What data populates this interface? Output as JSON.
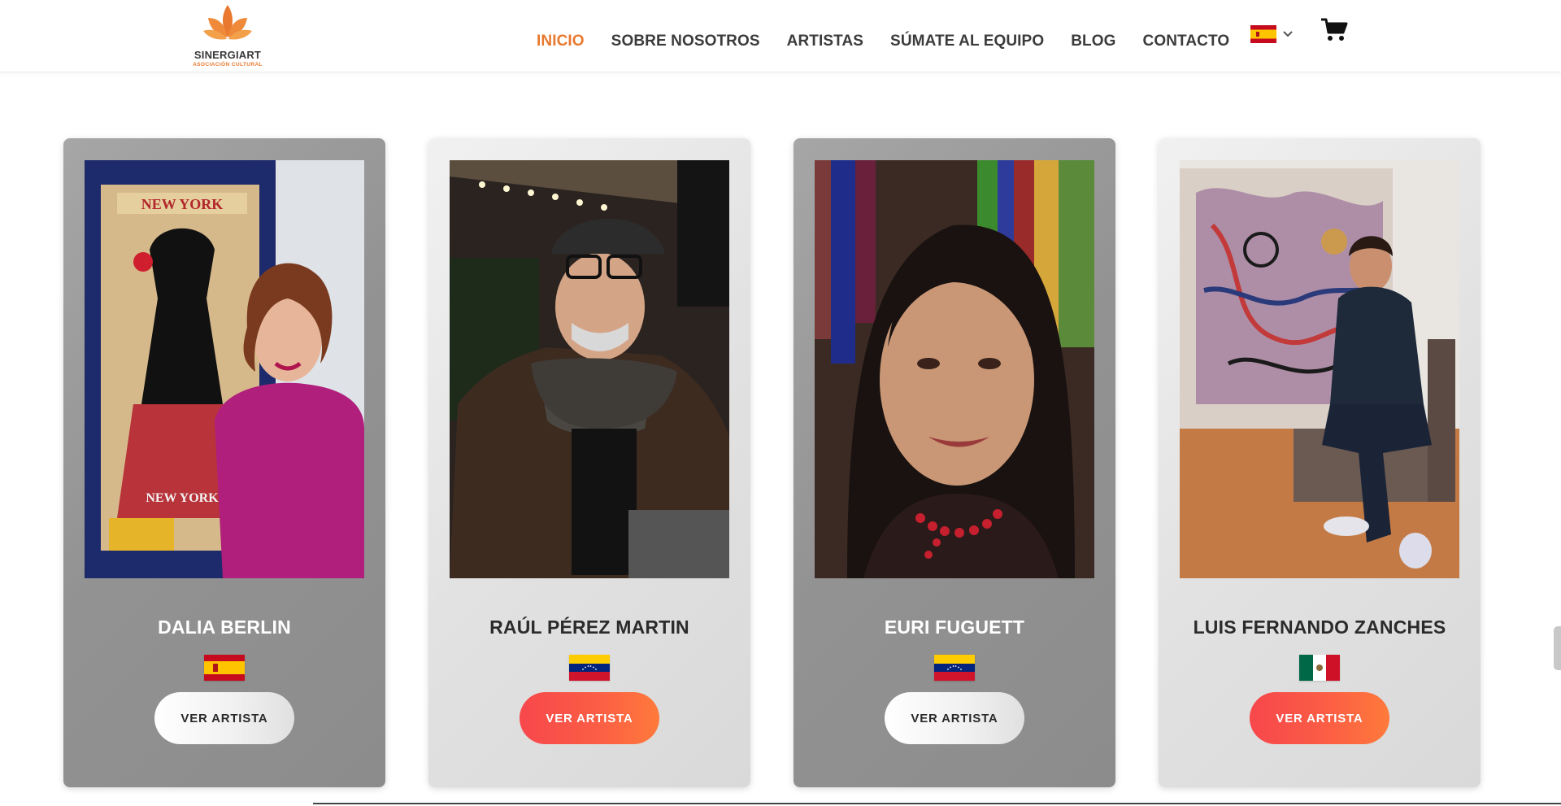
{
  "logo": {
    "name": "SINERGIART",
    "subtitle": "ASOCIACIÓN CULTURAL",
    "color": "#e8792e"
  },
  "nav": {
    "items": [
      {
        "label": "INICIO",
        "active": true
      },
      {
        "label": "SOBRE NOSOTROS",
        "active": false
      },
      {
        "label": "ARTISTAS",
        "active": false
      },
      {
        "label": "SÚMATE AL EQUIPO",
        "active": false
      },
      {
        "label": "BLOG",
        "active": false
      },
      {
        "label": "CONTACTO",
        "active": false
      }
    ],
    "language_flag": "spain-flag-icon",
    "cart_icon": "cart-icon"
  },
  "artists": [
    {
      "name": "DALIA BERLIN",
      "country_flag": "spain-flag-icon",
      "button_label": "VER ARTISTA",
      "card_style": "dark",
      "button_style": "white"
    },
    {
      "name": "RAÚL PÉREZ MARTIN",
      "country_flag": "venezuela-flag-icon",
      "button_label": "VER ARTISTA",
      "card_style": "light",
      "button_style": "orange"
    },
    {
      "name": "EURI FUGUETT",
      "country_flag": "venezuela-flag-icon",
      "button_label": "VER ARTISTA",
      "card_style": "dark",
      "button_style": "white"
    },
    {
      "name": "LUIS FERNANDO ZANCHES",
      "country_flag": "mexico-flag-icon",
      "button_label": "VER ARTISTA",
      "card_style": "light",
      "button_style": "orange"
    }
  ],
  "colors": {
    "accent": "#e8792e",
    "button_orange_start": "#f7474c",
    "button_orange_end": "#ff7a3b"
  }
}
